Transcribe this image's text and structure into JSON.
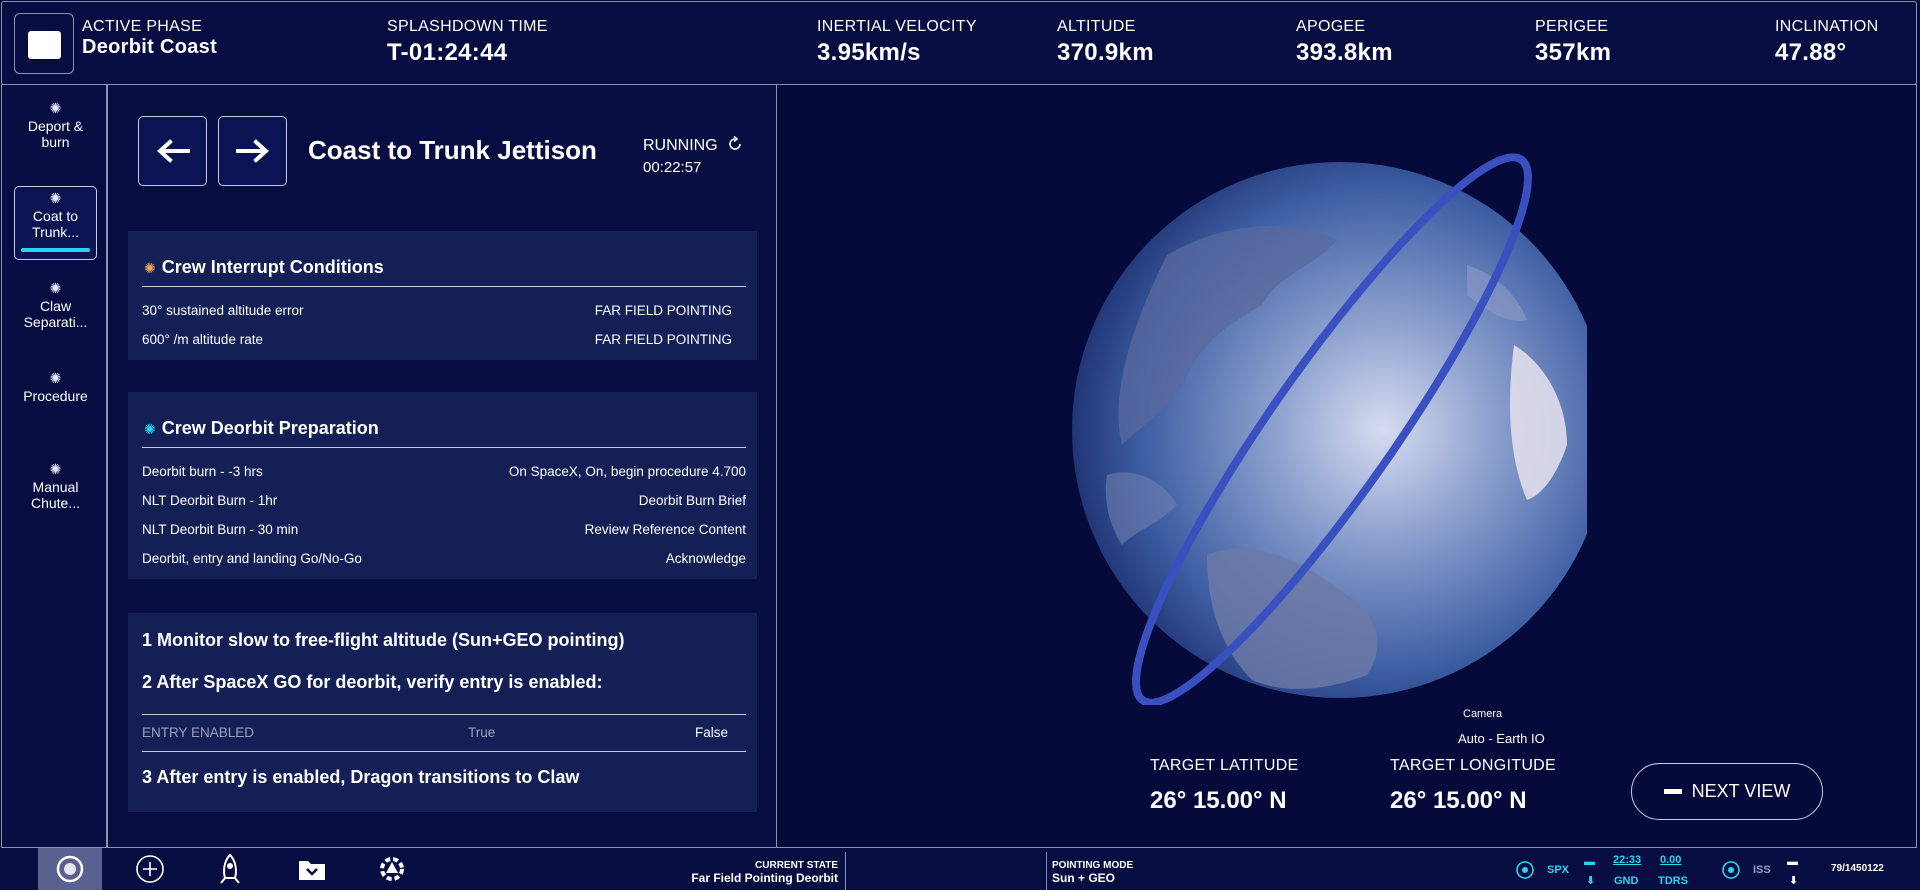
{
  "header": {
    "phase_label": "ACTIVE PHASE",
    "phase_value": "Deorbit Coast",
    "metrics": [
      {
        "label": "SPLASHDOWN TIME",
        "value": "T-01:24:44"
      },
      {
        "label": "INERTIAL VELOCITY",
        "value": "3.95km/s"
      },
      {
        "label": "ALTITUDE",
        "value": "370.9km"
      },
      {
        "label": "APOGEE",
        "value": "393.8km"
      },
      {
        "label": "PERIGEE",
        "value": "357km"
      },
      {
        "label": "INCLINATION",
        "value": "47.88°"
      }
    ]
  },
  "nav": {
    "items": [
      {
        "label": "Deport & burn"
      },
      {
        "label": "Coat to Trunk..."
      },
      {
        "label": "Claw Separati..."
      },
      {
        "label": "Procedure"
      },
      {
        "label": "Manual Chute..."
      }
    ]
  },
  "step": {
    "title": "Coast to Trunk Jettison",
    "status": "RUNNING",
    "elapsed": "00:22:57"
  },
  "interrupt": {
    "title": "Crew Interrupt Conditions",
    "rows": [
      {
        "left": "30° sustained altitude error",
        "right": "FAR FIELD POINTING"
      },
      {
        "left": "600° /m altitude rate",
        "right": "FAR FIELD POINTING"
      }
    ]
  },
  "deorbit_prep": {
    "title": "Crew Deorbit Preparation",
    "rows": [
      {
        "left": "Deorbit burn - -3 hrs",
        "right": "On SpaceX, On, begin procedure 4.700"
      },
      {
        "left": "NLT Deorbit Burn - 1hr",
        "right": "Deorbit Burn Brief"
      },
      {
        "left": "NLT Deorbit Burn - 30 min",
        "right": "Review Reference Content"
      },
      {
        "left": "Deorbit, entry and landing Go/No-Go",
        "right": "Acknowledge"
      }
    ]
  },
  "procedure": {
    "step1": "1 Monitor slow to free-flight altitude (Sun+GEO pointing)",
    "step2": "2 After SpaceX GO for deorbit, verify entry is enabled:",
    "entry_label": "ENTRY ENABLED",
    "entry_true": "True",
    "entry_false": "False",
    "step3": "3 After entry is enabled, Dragon transitions to Claw"
  },
  "globe": {
    "target_lat_label": "TARGET LATITUDE",
    "target_lat_value": "26° 15.00° N",
    "target_lon_label": "TARGET LONGITUDE",
    "target_lon_value": "26° 15.00° N",
    "camera_label": "Camera",
    "camera_value": "Auto - Earth IO",
    "next_view": "NEXT VIEW"
  },
  "bottom": {
    "current_state_label": "CURRENT STATE",
    "current_state_value": "Far Field Pointing Deorbit",
    "pointing_mode_label": "POINTING MODE",
    "pointing_mode_value": "Sun + GEO",
    "spx_label": "SPX",
    "gnd_time": "22:33",
    "gnd_label": "GND",
    "tdrs_value": "0.00",
    "tdrs_label": "TDRS",
    "iss_label": "ISS",
    "counter": "79/1450122"
  },
  "colors": {
    "background": "#050a3a",
    "panel": "#070d40",
    "card": "#142055",
    "accent": "#29d4f2",
    "interrupt_icon": "#f0a75a"
  }
}
